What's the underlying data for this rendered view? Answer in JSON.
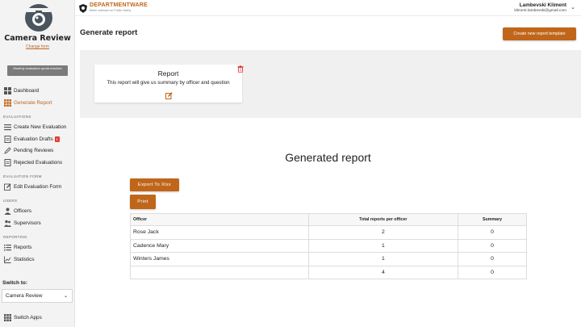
{
  "sidebar": {
    "app_title": "Camera Review",
    "change_form": "Change form",
    "quota_message": "Monthly evaluation quota reached",
    "items": {
      "dashboard": "Dashboard",
      "generate_report": "Generate Report",
      "create_evaluation": "Create New Evaluation",
      "evaluation_drafts": "Evaluation Drafts",
      "evaluation_drafts_badge": "1",
      "pending_reviews": "Pending Reviews",
      "rejected_evaluations": "Rejected Evaluations",
      "edit_evaluation_form": "Edit Evaluation Form",
      "officers": "Officers",
      "supervisors": "Supervisors",
      "reports": "Reports",
      "statistics": "Statistics"
    },
    "sections": {
      "evaluations": "EVALUATIONS",
      "evaluation_form": "EVALUATION FORM",
      "users": "USERS",
      "reporting": "REPORTING"
    },
    "switch_to_label": "Switch to:",
    "switch_value": "Camera Review",
    "switch_apps": "Switch Apps"
  },
  "topbar": {
    "brand_name": "DEPARTMENTWARE",
    "brand_tagline": "Better software for Public Safety",
    "user_name": "Lambevski Kliment",
    "user_email": "kliment.lambevski@gmail.com"
  },
  "main": {
    "page_title": "Generate report",
    "create_template_button": "Create new report template",
    "report_card": {
      "title": "Report",
      "description": "This report will give us summary by officer and question"
    },
    "generated_title": "Generated report",
    "export_button": "Export To Xlsx",
    "print_button": "Print",
    "table": {
      "headers": [
        "Officer",
        "Total reports per officer",
        "Summary"
      ],
      "rows": [
        {
          "officer": "Rose Jack",
          "total": "2",
          "summary": "0"
        },
        {
          "officer": "Cadence Mary",
          "total": "1",
          "summary": "0"
        },
        {
          "officer": "Winters James",
          "total": "1",
          "summary": "0"
        },
        {
          "officer": "",
          "total": "4",
          "summary": "0"
        }
      ]
    }
  },
  "colors": {
    "accent": "#c0661a",
    "sidebar_bg": "#f3f3f3",
    "badge": "#e53935",
    "delete": "#e53935"
  },
  "icons": {
    "logo": "camera-icon",
    "dashboard": "grid-icon",
    "generate_report": "grid-icon",
    "create_evaluation": "list-icon",
    "evaluation_drafts": "document-icon",
    "pending_reviews": "pen-icon",
    "rejected_evaluations": "document-icon",
    "edit_evaluation_form": "edit-icon",
    "officers": "user-icon",
    "supervisors": "users-icon",
    "reports": "list-icon",
    "statistics": "chart-icon",
    "switch_apps": "grid-icon",
    "delete": "trash-icon",
    "edit": "edit-icon"
  }
}
